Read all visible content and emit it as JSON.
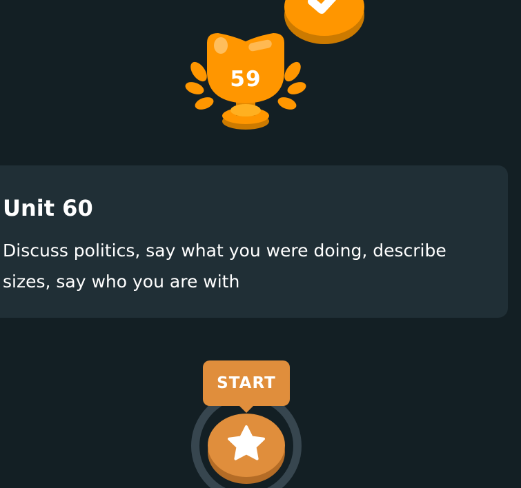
{
  "path": {
    "completed_node": {
      "icon": "checkmark-icon",
      "color": "#ff9600"
    },
    "trophy": {
      "icon": "trophy-icon",
      "number": "59",
      "color": "#ff9600"
    },
    "unit": {
      "title": "Unit 60",
      "description": "Discuss politics, say what you were doing, describe sizes, say who you are with"
    },
    "start_bubble": {
      "label": "START",
      "color": "#e08e3c"
    },
    "start_node": {
      "icon": "star-icon",
      "color": "#e08e3c"
    }
  },
  "colors": {
    "background": "#131f24",
    "card": "#202f36",
    "text": "#ffffff",
    "accent": "#ff9600"
  }
}
